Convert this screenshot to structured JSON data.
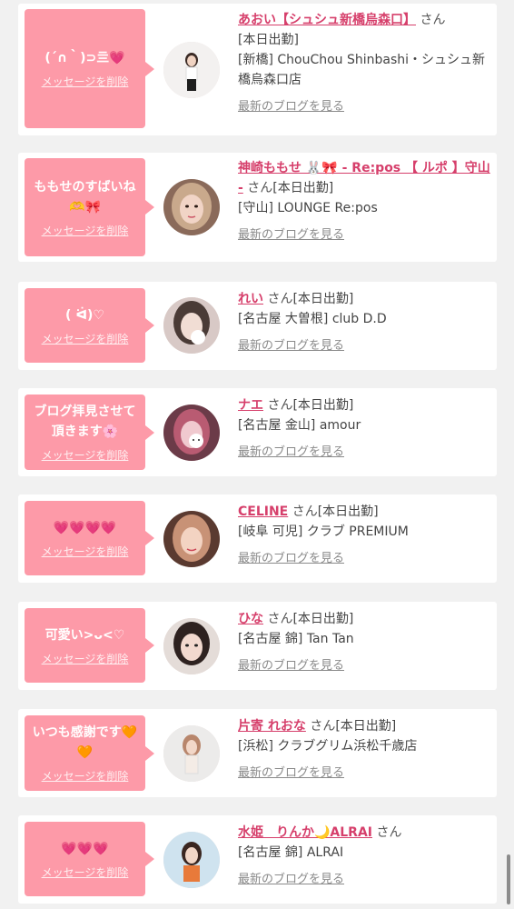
{
  "delete_label": "メッセージを削除",
  "blog_label": "最新のブログを見る",
  "suffix": "さん",
  "accent_color": "#fd9aa8",
  "name_color": "#d63f6b",
  "cards": [
    {
      "message": "(´∩｀)⊃亖💗",
      "name": "あおい【シュシュ新橋烏森口】",
      "status": "[本日出勤]",
      "shop": "[新橋] ChouChou Shinbashi・シュシュ新橋烏森口店"
    },
    {
      "message": "ももせのすばいね🫶🎀",
      "name": "神崎ももせ 🐰🎀 - Re:pos 【 ルポ 】守山 -",
      "status": "[本日出勤]",
      "shop": "[守山] LOUNGE Re:pos"
    },
    {
      "message": "( ᐛ)♡",
      "name": "れい",
      "status": "[本日出勤]",
      "shop": "[名古屋 大曽根] club D.D"
    },
    {
      "message": "ブログ拝見させて頂きます🌸",
      "name": "ナエ",
      "status": "[本日出勤]",
      "shop": "[名古屋 金山] amour"
    },
    {
      "message": "💗💗💗💗",
      "name": "CELINE",
      "status": "[本日出勤]",
      "shop": "[岐阜 可児] クラブ PREMIUM"
    },
    {
      "message": "可愛い>ᴗ<♡",
      "name": "ひな",
      "status": "[本日出勤]",
      "shop": "[名古屋 錦] Tan Tan"
    },
    {
      "message": "いつも感謝です🧡🧡",
      "name": "片寄 れおな",
      "status": "[本日出勤]",
      "shop": "[浜松] クラブグリム浜松千歳店"
    },
    {
      "message": "💗💗💗",
      "name": "水姫　りんか🌙ALRAI",
      "status": "",
      "shop": "[名古屋 錦] ALRAI"
    }
  ]
}
